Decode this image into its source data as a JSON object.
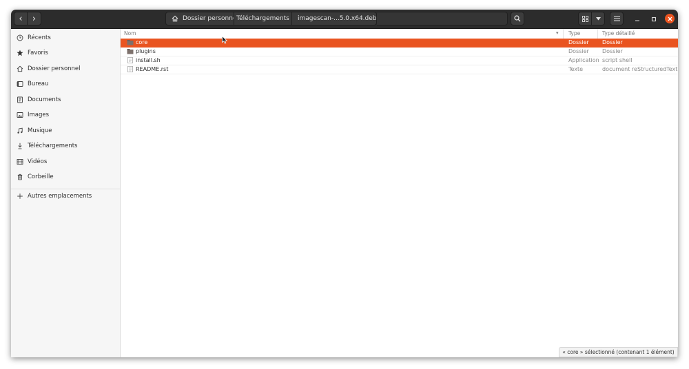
{
  "nav": {
    "back_glyph": "‹",
    "forward_glyph": "›"
  },
  "path": {
    "home_label": "Dossier personnel",
    "downloads_label": "Téléchargements",
    "current_label": "imagescan-...5.0.x64.deb"
  },
  "sidebar": {
    "items": [
      {
        "label": "Récents",
        "icon": "clock-icon"
      },
      {
        "label": "Favoris",
        "icon": "star-icon"
      },
      {
        "label": "Dossier personnel",
        "icon": "home-icon"
      },
      {
        "label": "Bureau",
        "icon": "desktop-icon"
      },
      {
        "label": "Documents",
        "icon": "document-icon"
      },
      {
        "label": "Images",
        "icon": "image-icon"
      },
      {
        "label": "Musique",
        "icon": "music-icon"
      },
      {
        "label": "Téléchargements",
        "icon": "download-icon"
      },
      {
        "label": "Vidéos",
        "icon": "video-icon"
      },
      {
        "label": "Corbeille",
        "icon": "trash-icon"
      }
    ],
    "other_locations": {
      "label": "Autres emplacements",
      "icon": "plus-icon"
    }
  },
  "columns": {
    "name": "Nom",
    "type": "Type",
    "detail": "Type détaillé"
  },
  "files": [
    {
      "name": "core",
      "type": "Dossier",
      "detail": "Dossier",
      "kind": "folder",
      "selected": true
    },
    {
      "name": "plugins",
      "type": "Dossier",
      "detail": "Dossier",
      "kind": "folder",
      "selected": false
    },
    {
      "name": "install.sh",
      "type": "Application",
      "detail": "script shell",
      "kind": "file",
      "selected": false
    },
    {
      "name": "README.rst",
      "type": "Texte",
      "detail": "document reStructuredText",
      "kind": "text",
      "selected": false
    }
  ],
  "status": {
    "text": "« core » sélectionné  (contenant 1 élément)"
  },
  "colors": {
    "accent": "#e95420",
    "headerbar": "#2c2c2c",
    "folder": "#6a5f5b"
  }
}
